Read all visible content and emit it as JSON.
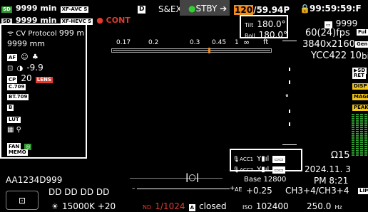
{
  "top": {
    "media_a_time": "9999 min",
    "media_a_codec": "XF-AVC S",
    "media_b_time": "9999 min",
    "media_b_codec": "XF-HEVC S",
    "cont": "CONT",
    "d_tag": "D",
    "slot_mode": "S&EXT",
    "status": "STBY",
    "frame_rate": "/59.94P",
    "frame_rate_hl": "120",
    "timecode": "99:59:59:F",
    "lock_icon": "lock-icon"
  },
  "left_panel": {
    "cv_protocol": "CV Protocol",
    "cv_dist": "999 m",
    "focus_dist": "9999 mm",
    "af_label": "AF",
    "exposure": "-9.9",
    "cp_label": "CP",
    "cp_value": "20",
    "lens": "LENS",
    "gamma": "C.709",
    "colorspace": "BT.709",
    "lut": "LUT",
    "fan": "FAN",
    "memo": "MEMO"
  },
  "focus_scale": {
    "labels": [
      "0.17",
      "0.2",
      "0.3",
      "0.45",
      "1",
      "∞",
      "ft"
    ]
  },
  "right_panel": {
    "tilt": "180.0°",
    "roll": "180.0°",
    "tilt_label": "Tilt",
    "roll_label": "Roll",
    "card_time": "9999",
    "fps": "60(24)fps",
    "resolution": "3840x2160",
    "color_sampling": "YCC422 10",
    "full": "Ful",
    "gen": "Gen",
    "bit": "bi",
    "ret": "RET",
    "disp": "DISP",
    "magn": "MAGN",
    "peak": "PEAK",
    "sd_label": "SD"
  },
  "bottom": {
    "clip_name": "AA1234D999",
    "mic1": "ACC1",
    "mic2": "ACC2",
    "audio_label": "Ω15",
    "date": "2024.11. 3",
    "time": "PM  8:21",
    "dd": "DD DD DD DD",
    "white_balance": "15000K +20",
    "ae": "AE",
    "ae_value": "+0.25",
    "channels": "CH3+4/CH3+4",
    "lim": "LIM",
    "nd": "ND",
    "shutter": "1/1024",
    "iris_tag": "A",
    "iris": "closed",
    "iso_label": "ISO",
    "iso": "102400",
    "base": "Base 12800",
    "freq": "250.0",
    "hz": "Hz"
  },
  "colors": {
    "accent_orange": "#f28a1e",
    "record_red": "#e23b2e",
    "status_green": "#2f9a2f"
  }
}
